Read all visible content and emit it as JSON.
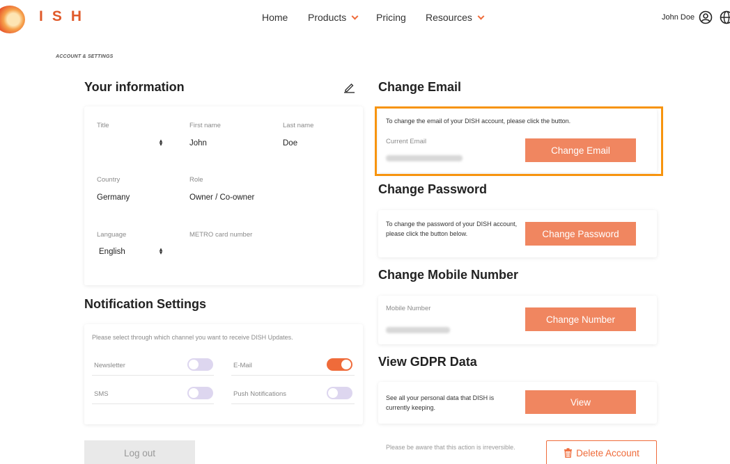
{
  "brand": {
    "name": "ISH"
  },
  "nav": {
    "home": "Home",
    "products": "Products",
    "pricing": "Pricing",
    "resources": "Resources"
  },
  "user": {
    "name": "John Doe"
  },
  "breadcrumb": "ACCOUNT & SETTINGS",
  "your_info": {
    "title": "Your information",
    "fields": {
      "title_label": "Title",
      "title_value": "",
      "first_name_label": "First name",
      "first_name_value": "John",
      "last_name_label": "Last name",
      "last_name_value": "Doe",
      "country_label": "Country",
      "country_value": "Germany",
      "role_label": "Role",
      "role_value": "Owner / Co-owner",
      "language_label": "Language",
      "language_value": "English",
      "metro_label": "METRO card number",
      "metro_value": ""
    }
  },
  "notifications": {
    "title": "Notification Settings",
    "description": "Please select through which channel you want to receive DISH Updates.",
    "channels": [
      {
        "label": "Newsletter",
        "enabled": false
      },
      {
        "label": "E-Mail",
        "enabled": true
      },
      {
        "label": "SMS",
        "enabled": false
      },
      {
        "label": "Push Notifications",
        "enabled": false
      }
    ]
  },
  "logout_label": "Log out",
  "change_email": {
    "title": "Change Email",
    "description": "To change the email of your DISH account, please click the button.",
    "current_label": "Current Email",
    "button": "Change Email"
  },
  "change_password": {
    "title": "Change Password",
    "description": "To change the password of your DISH account, please click the button below.",
    "button": "Change Password"
  },
  "change_mobile": {
    "title": "Change Mobile Number",
    "label": "Mobile Number",
    "button": "Change Number"
  },
  "gdpr": {
    "title": "View GDPR Data",
    "description": "See all your personal data that DISH is currently keeping.",
    "button": "View"
  },
  "delete_account": {
    "warning": "Please be aware that this action is irreversible.",
    "button": "Delete Account"
  },
  "colors": {
    "accent": "#ef6b3a",
    "button": "#f08660",
    "highlight": "#f7940e",
    "toggle_off": "#ddd6ef"
  },
  "icons": [
    "user-circle-icon",
    "globe-icon",
    "edit-pencil-icon",
    "chevron-down-icon",
    "select-arrows-icon",
    "trash-icon"
  ]
}
